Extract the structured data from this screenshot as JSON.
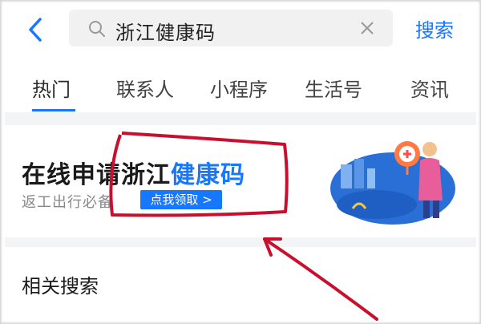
{
  "search": {
    "query": "浙江健康码",
    "submit_label": "搜索"
  },
  "tabs": [
    {
      "label": "热门",
      "active": true
    },
    {
      "label": "联系人",
      "active": false
    },
    {
      "label": "小程序",
      "active": false
    },
    {
      "label": "生活号",
      "active": false
    },
    {
      "label": "资讯",
      "active": false
    }
  ],
  "banner": {
    "title_prefix": "在线申请浙江",
    "title_highlight": "健康码",
    "subtitle": "返工出行必备",
    "cta_label": "点我领取 >"
  },
  "related": {
    "heading": "相关搜索"
  },
  "colors": {
    "accent": "#1677ff",
    "annotation": "#c8102e"
  },
  "icons": [
    "back-arrow-icon",
    "search-icon",
    "clear-icon"
  ]
}
